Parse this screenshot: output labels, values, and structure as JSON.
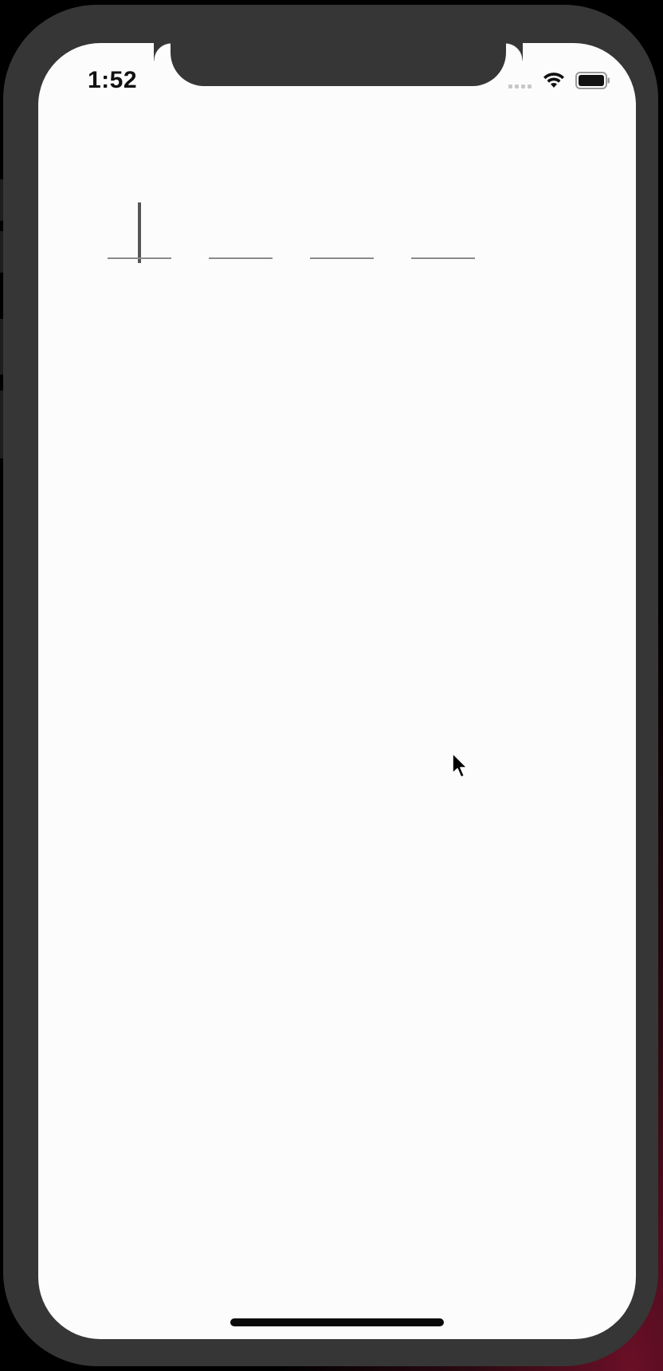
{
  "status_bar": {
    "time": "1:52",
    "signal_icon": "cellular-signal-icon",
    "wifi_icon": "wifi-icon",
    "battery_icon": "battery-icon"
  },
  "otp": {
    "slots": [
      {
        "value": "",
        "focused": true
      },
      {
        "value": "",
        "focused": false
      },
      {
        "value": "",
        "focused": false
      },
      {
        "value": "",
        "focused": false
      }
    ]
  },
  "colors": {
    "screen_background": "#fcfcfc",
    "device_frame": "#363636",
    "underline": "#8a8a8a",
    "caret": "#555555"
  },
  "pointer_icon": "mouse-pointer-icon"
}
